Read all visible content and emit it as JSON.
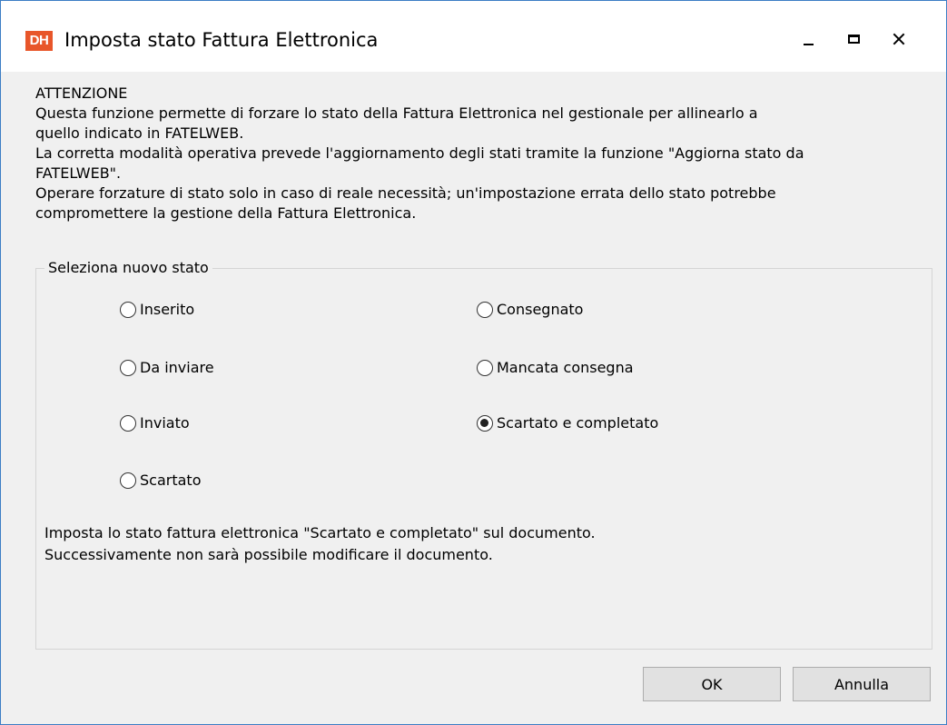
{
  "window": {
    "logo_text": "DH",
    "title": "Imposta stato Fattura Elettronica",
    "accent_color": "#e8562a"
  },
  "warning": {
    "lines": [
      "ATTENZIONE",
      "Questa funzione permette di forzare lo stato della Fattura Elettronica nel gestionale per allinearlo a",
      "quello indicato in FATELWEB.",
      "La corretta modalità operativa prevede l'aggiornamento degli stati tramite la funzione \"Aggiorna stato da",
      "FATELWEB\".",
      "Operare forzature di stato solo in caso di reale necessità; un'impostazione errata dello stato potrebbe",
      "compromettere la gestione della Fattura Elettronica."
    ]
  },
  "status_group": {
    "legend": "Seleziona nuovo stato",
    "options": [
      {
        "label": "Inserito",
        "checked": false
      },
      {
        "label": "Da inviare",
        "checked": false
      },
      {
        "label": "Inviato",
        "checked": false
      },
      {
        "label": "Scartato",
        "checked": false
      },
      {
        "label": "Consegnato",
        "checked": false
      },
      {
        "label": "Mancata consegna",
        "checked": false
      },
      {
        "label": "Scartato e completato",
        "checked": true
      }
    ],
    "description_lines": [
      "Imposta lo stato fattura elettronica \"Scartato e completato\" sul documento.",
      "Successivamente non sarà possibile modificare il documento."
    ]
  },
  "buttons": {
    "ok": "OK",
    "cancel": "Annulla"
  }
}
